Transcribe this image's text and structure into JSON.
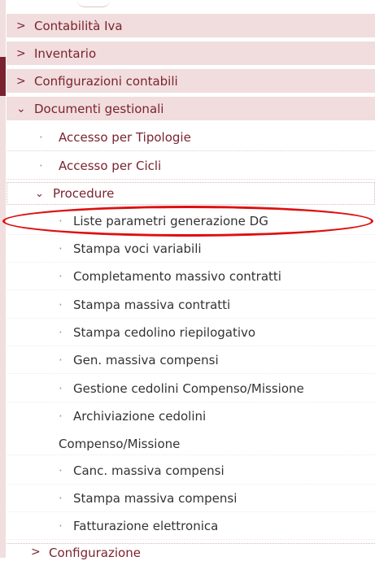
{
  "menu": {
    "contabilita_iva": "Contabilità Iva",
    "inventario": "Inventario",
    "configurazioni_contabili": "Configurazioni contabili",
    "documenti_gestionali": "Documenti gestionali",
    "accesso_tipologie": "Accesso per Tipologie",
    "accesso_cicli": "Accesso per Cicli",
    "procedure": "Procedure",
    "procedure_items": [
      "Liste parametri generazione DG",
      "Stampa voci variabili",
      "Completamento massivo contratti",
      "Stampa massiva contratti",
      "Stampa cedolino riepilogativo",
      "Gen. massiva compensi",
      "Gestione cedolini Compenso/Missione",
      "Archiviazione cedolini",
      "Compenso/Missione",
      "Canc. massiva compensi",
      "Stampa massiva compensi",
      "Fatturazione elettronica"
    ],
    "configurazione": "Configurazione"
  },
  "symbols": {
    "caret_right": ">",
    "caret_down": "⌄",
    "bullet": "·"
  },
  "colors": {
    "menu_header_bg": "#f1dddd",
    "menu_text": "#7a2330",
    "annotation": "#dd1010"
  }
}
